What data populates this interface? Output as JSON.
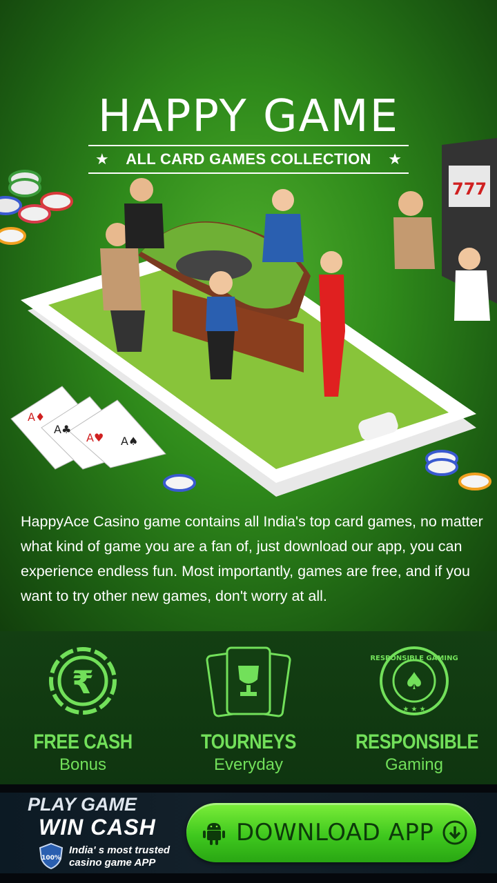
{
  "hero": {
    "title": "HAPPY GAME",
    "subtitle": "ALL CARD GAMES COLLECTION",
    "description": "HappyAce Casino game contains all India's top card games, no matter what kind of game you are a fan of, just download our app, you can experience endless fun. Most importantly, games are free, and if you want to try other new games, don't worry at all."
  },
  "features": [
    {
      "title": "FREE CASH",
      "subtitle": "Bonus",
      "icon": "rupee-coin-icon"
    },
    {
      "title": "TOURNEYS",
      "subtitle": "Everyday",
      "icon": "trophy-cards-icon"
    },
    {
      "title": "RESPONSIBLE",
      "subtitle": "Gaming",
      "icon": "responsible-gaming-badge-icon",
      "badge_text": "RESPONSIBLE GAMING"
    }
  ],
  "banner": {
    "line1": "PLAY GAME",
    "line2": "WIN CASH",
    "trusted": "India' s most trusted casino game APP",
    "shield_text": "100%",
    "download_label": "DOWNLOAD APP"
  },
  "colors": {
    "accent_green": "#72e05a",
    "button_green": "#3fc81e",
    "bg_dark": "#133f12"
  }
}
